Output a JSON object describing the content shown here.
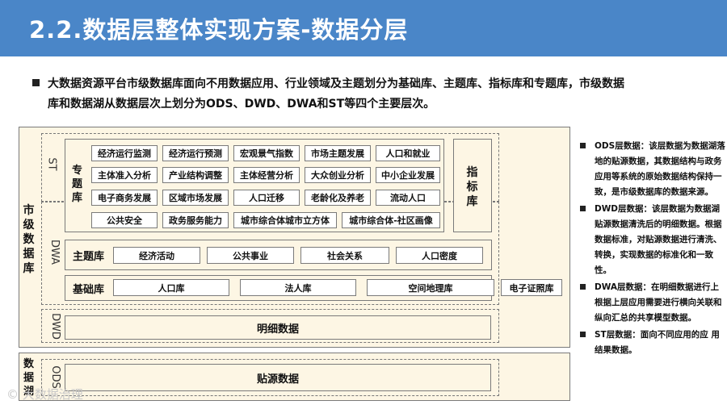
{
  "title": "2.2.数据层整体实现方案-数据分层",
  "intro": {
    "line1": "大数据资源平台市级数据库面向不用数据应用、行业领域及主题划分为基础库、主题库、指标库和专题库，市级数据",
    "line2": "库和数据湖从数据层次上划分为ODS、DWD、DWA和ST等四个主要层次。"
  },
  "diagram": {
    "city_db_label": "市级数据库",
    "lake_label": "数据湖",
    "layers": {
      "st": "ST",
      "dwa": "DWA",
      "dwd": "DWD",
      "ods": "ODS"
    },
    "topic_db_label": "专题库",
    "indicator_db_label": "指标库",
    "topic_cells": [
      [
        "经济运行监测",
        "经济运行预测",
        "宏观景气指数",
        "市场主题发展",
        "人口和就业"
      ],
      [
        "主体准入分析",
        "产业结构调整",
        "主体经营分析",
        "大众创业分析",
        "中小企业发展"
      ],
      [
        "电子商务发展",
        "区域市场发展",
        "人口迁移",
        "老龄化及养老",
        "流动人口"
      ],
      [
        "公共安全",
        "政务服务能力",
        "城市综合体城市立方体",
        "城市综合体-社区画像"
      ]
    ],
    "subject_label": "主题库",
    "subject_cells": [
      "经济活动",
      "公共事业",
      "社会关系",
      "人口密度"
    ],
    "base_label": "基础库",
    "base_cells": [
      "人口库",
      "法人库",
      "空间地理库",
      "电子证照库"
    ],
    "detail_bar": "明细数据",
    "source_bar": "贴源数据"
  },
  "notes": [
    "ODS层数据：该层数据为数据湖落地的贴源数据，其数据结构与政务应用等系统的原始数据结构保持一致，是市级数据库的数据来源。",
    "DWD层数据：该层数据为数据湖贴源数据清洗后的明细数据。根据数据标准，对贴源数据进行清洗、转换，实现数据的标准化和一致性。",
    "DWA层数据：在明细数据进行上根据上层应用需要进行横向关联和纵向汇总的共享模型数据。",
    "ST层数据：面向不同应用的应 用结果数据。"
  ],
  "watermark": "大数据治理"
}
